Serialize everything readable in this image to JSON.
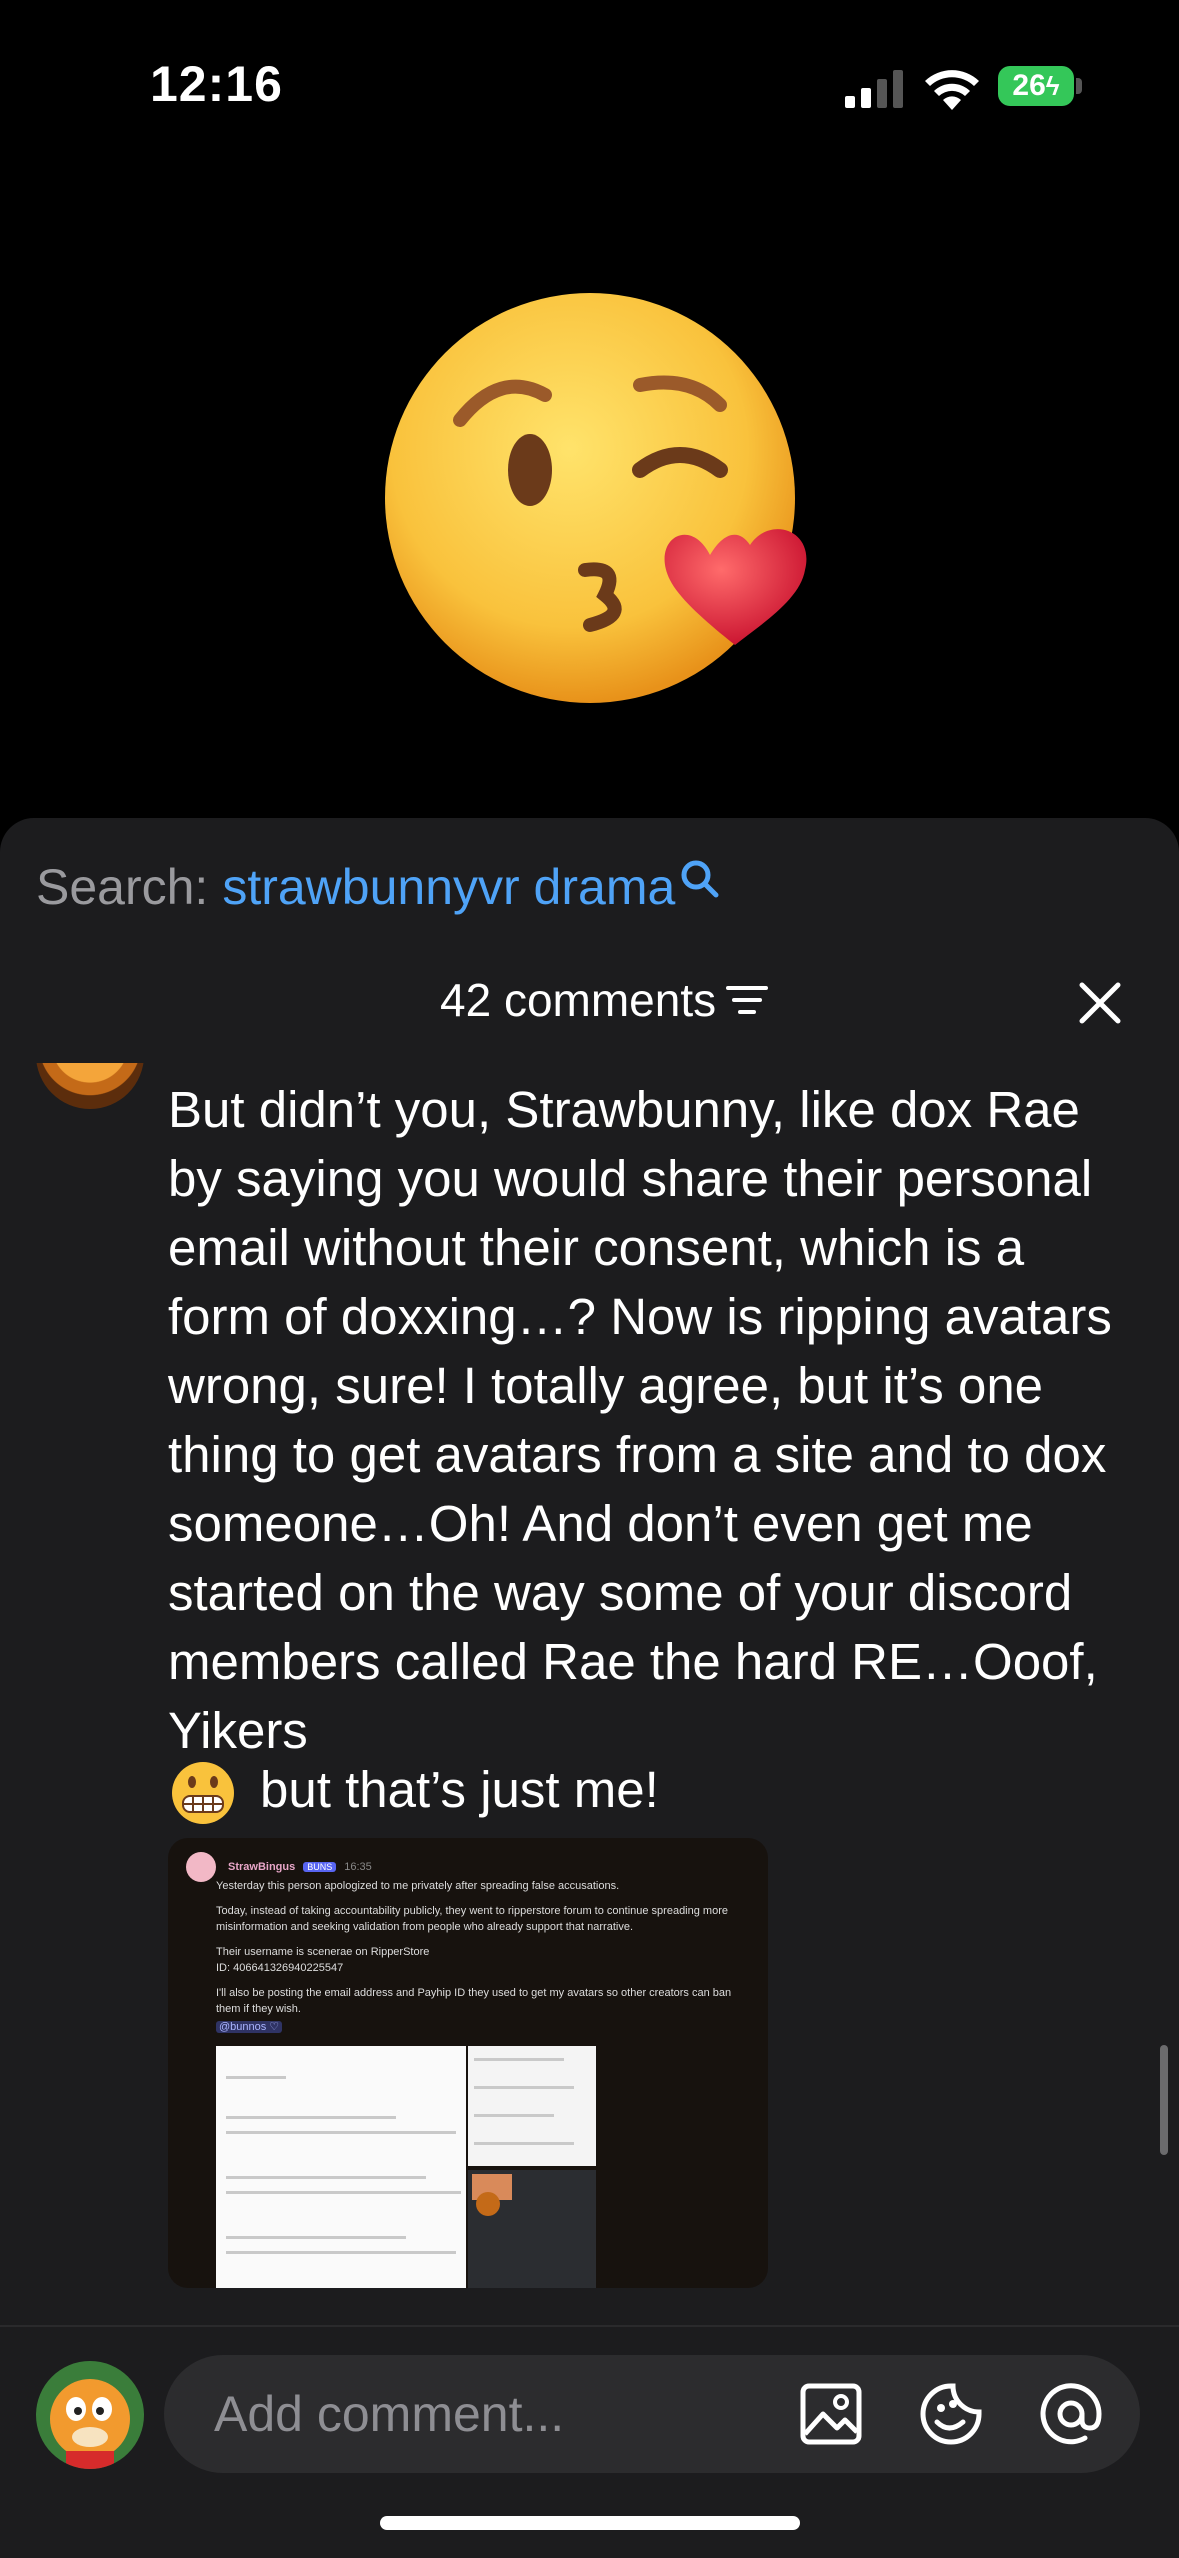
{
  "status_bar": {
    "time": "12:16",
    "battery_percent": "26"
  },
  "hero_emoji": {
    "icon": "kissing-face-with-heart-emoji"
  },
  "search": {
    "prefix": "Search:",
    "term": "strawbunnyvr drama"
  },
  "comments": {
    "count_label": "42 comments"
  },
  "comment": {
    "text": "But didn’t you, Strawbunny, like dox Rae by saying you would share their personal email without their consent, which is a form of doxxing…? Now is ripping avatars wrong, sure! I totally agree, but it’s one thing to get avatars from a site and to dox someone…Oh! And don’t even get me started on the way some of your discord members called Rae the hard RE…Ooof, Yikers",
    "tail_emoji": "grimacing-face-emoji",
    "tail_text": "but that’s just me!"
  },
  "attachment": {
    "author": "StrawBingus",
    "badge": "BUNS",
    "time": "16:35",
    "paragraphs": [
      "Yesterday this person apologized to me privately after spreading false accusations.",
      "Today, instead of taking accountability publicly, they went to ripperstore forum to continue spreading more misinformation and seeking validation from people who already support that narrative.",
      "Their username is scenerae on RipperStore",
      "ID: 406641326940225547",
      "I'll also be posting the email address and Payhip ID they used to get my avatars so other creators can ban them if they wish."
    ],
    "mention": "@bunnos ♡"
  },
  "input": {
    "placeholder": "Add comment..."
  }
}
